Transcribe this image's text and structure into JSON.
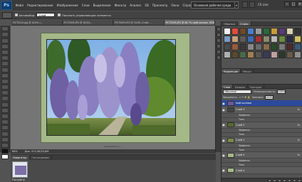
{
  "menubar": {
    "logo": "Ps",
    "items": [
      "Файл",
      "Редактирование",
      "Изображение",
      "Слои",
      "Выделение",
      "Фильтр",
      "Анализ",
      "3D",
      "Просмотр",
      "Окно",
      "Справка"
    ],
    "zoom": "66,7",
    "workspace": "Основная рабочая среда",
    "cs_live": "CS Live"
  },
  "options": {
    "autoselect_label": "Автовыбор:",
    "autoselect_value": "Слой",
    "show_controls_label": "Показать управляющие элементы"
  },
  "documents": {
    "tabs": [
      "PICT0010.jpg @ 16,6% (...",
      "PICT0005.JPG @ 16,6%...",
      "PICT0005.JPG @ 16,6% (Слой ...",
      "PICT0005.JPG @ 66,7% (мой коллаж, RGB/8) *"
    ],
    "active_index": 3
  },
  "status": {
    "zoom": "66%",
    "doc": "Док: 913,4K/20,8M"
  },
  "navigator": {
    "tabs": [
      "Навигатор",
      "Гистограмма"
    ],
    "zoom": "Послойно"
  },
  "right_panel": {
    "top_tabs": [
      "Образцы",
      "Стили"
    ],
    "adj_tabs": [
      "Коррекция",
      "Маски"
    ],
    "layers_tabs": [
      "Слои",
      "Каналы",
      "Контуры"
    ],
    "blend_mode": "Обычные",
    "opacity_label": "Непрозрачность:",
    "opacity_value": "100%",
    "lock_label": "Закрепить:",
    "fill_label": "Заливка:",
    "fill_value": "100%",
    "layers": [
      {
        "name": "мой коллаж",
        "selected": true,
        "fx": "",
        "thumb": "#6a5a9a"
      },
      {
        "name": "Слой 3",
        "selected": false,
        "fx": "fx",
        "thumb": "#444444"
      },
      {
        "name": "Эффекты",
        "sub": true
      },
      {
        "name": "Тень",
        "sub": true
      },
      {
        "name": "Слой 2",
        "selected": false,
        "fx": "fx",
        "thumb": "#556b2f"
      },
      {
        "name": "Эффекты",
        "sub": true
      },
      {
        "name": "Тень",
        "sub": true
      },
      {
        "name": "Слой 1",
        "selected": false,
        "fx": "fx",
        "thumb": "#7a8a4a"
      },
      {
        "name": "Эффекты",
        "sub": true
      },
      {
        "name": "Тень",
        "sub": true
      },
      {
        "name": "Слой 5",
        "selected": false,
        "fx": "fx",
        "thumb": "#a4b888"
      },
      {
        "name": "Эффекты",
        "sub": true
      },
      {
        "name": "Тень",
        "sub": true
      },
      {
        "name": "Слой 4",
        "selected": false,
        "fx": "",
        "thumb": "#a4b888"
      }
    ]
  },
  "photo": {
    "caption": "www.pphoto.ru · ...",
    "frame_color": "#a4b888"
  },
  "colors": {
    "selected_layer": "#2b4a9c"
  }
}
